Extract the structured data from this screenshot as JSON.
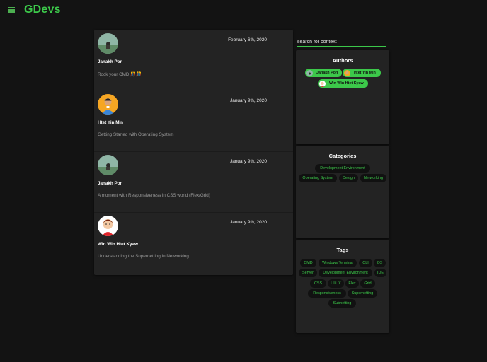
{
  "app": {
    "brand": "GDevs"
  },
  "search": {
    "placeholder": "search for context"
  },
  "posts": [
    {
      "date": "February 6th, 2020",
      "author": "Janakh Pon",
      "title": "Rock your CMD 🎊🎊"
    },
    {
      "date": "January 9th, 2020",
      "author": "Htet Yin Min",
      "title": "Getting Started with Operating System"
    },
    {
      "date": "January 9th, 2020",
      "author": "Janakh Pon",
      "title": "A moment with Responsiveness in CSS world (Flex/Grid)"
    },
    {
      "date": "January 9th, 2020",
      "author": "Win Win Htet Kyaw",
      "title": "Understanding the Supernetting in Networking"
    }
  ],
  "authors": {
    "heading": "Authors",
    "items": [
      "Janakh Pon",
      "Htet Yin Min",
      "Win Win Htet Kyaw"
    ]
  },
  "categories": {
    "heading": "Categories",
    "items": [
      "Development Environment",
      "Operating System",
      "Design",
      "Networking"
    ]
  },
  "tags": {
    "heading": "Tags",
    "items": [
      "CMD",
      "Windows Terminal",
      "CLI",
      "OS",
      "Server",
      "Development Environment",
      "IDE",
      "CSS",
      "UI/UX",
      "Flex",
      "Grid",
      "Responsiveness",
      "Supernetting",
      "Subnetting"
    ]
  },
  "colors": {
    "accent": "#3cc84a",
    "background": "#131313",
    "card": "#232323"
  },
  "icons": {
    "menu": "hamburger-menu-icon"
  }
}
